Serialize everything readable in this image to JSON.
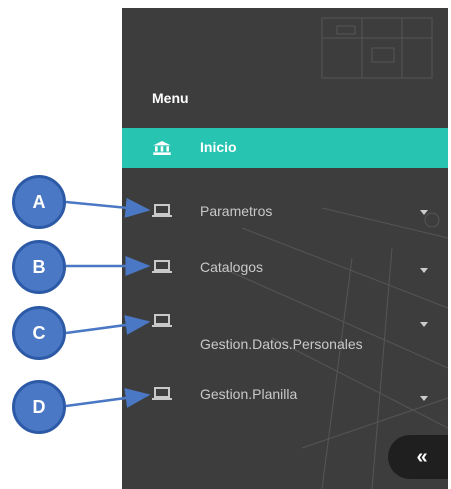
{
  "sidebar": {
    "menu_title": "Menu",
    "items": [
      {
        "label": "Inicio",
        "icon": "bank-icon",
        "active": true
      },
      {
        "label": "Parametros",
        "icon": "laptop-icon",
        "has_submenu": true
      },
      {
        "label": "Catalogos",
        "icon": "laptop-icon",
        "has_submenu": true
      },
      {
        "label": "Gestion.Datos.Personales",
        "icon": "laptop-icon",
        "has_submenu": true
      },
      {
        "label": "Gestion.Planilla",
        "icon": "laptop-icon",
        "has_submenu": true
      }
    ],
    "collapse_label": "«"
  },
  "callouts": [
    "A",
    "B",
    "C",
    "D"
  ],
  "colors": {
    "sidebar_bg": "#3d3d3d",
    "active_bg": "#27c4b2",
    "callout_fill": "#4a78c4",
    "callout_border": "#2d5aa6",
    "arrow": "#4a78c4"
  }
}
